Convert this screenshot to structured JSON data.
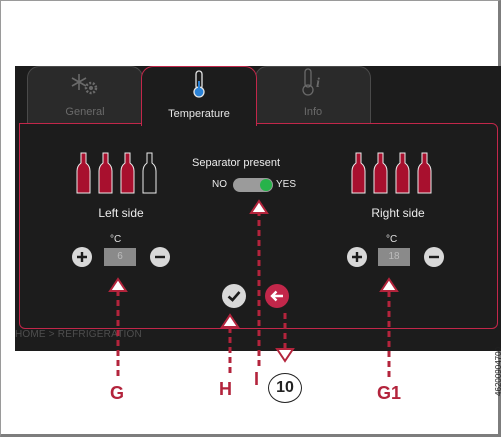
{
  "tabs": [
    {
      "label": "General",
      "icon": "gear-snowflake-icon",
      "active": false
    },
    {
      "label": "Temperature",
      "icon": "thermometer-icon",
      "active": true
    },
    {
      "label": "Info",
      "icon": "thermometer-info-icon",
      "active": false
    }
  ],
  "left": {
    "label": "Left side",
    "unit": "°C",
    "value": "6"
  },
  "right": {
    "label": "Right side",
    "unit": "°C",
    "value": "18"
  },
  "separator": {
    "title": "Separator present",
    "no": "NO",
    "yes": "YES",
    "state": "YES"
  },
  "breadcrumb": "HOME > REFRIGERATION",
  "callouts": {
    "g": "G",
    "h": "H",
    "i": "I",
    "ten": "10",
    "g1": "G1"
  },
  "doc_id": "46200904700",
  "colors": {
    "accent": "#c2274a",
    "bottle": "#a8102e",
    "toggle_on": "#27b34a",
    "callout": "#b3243c"
  }
}
